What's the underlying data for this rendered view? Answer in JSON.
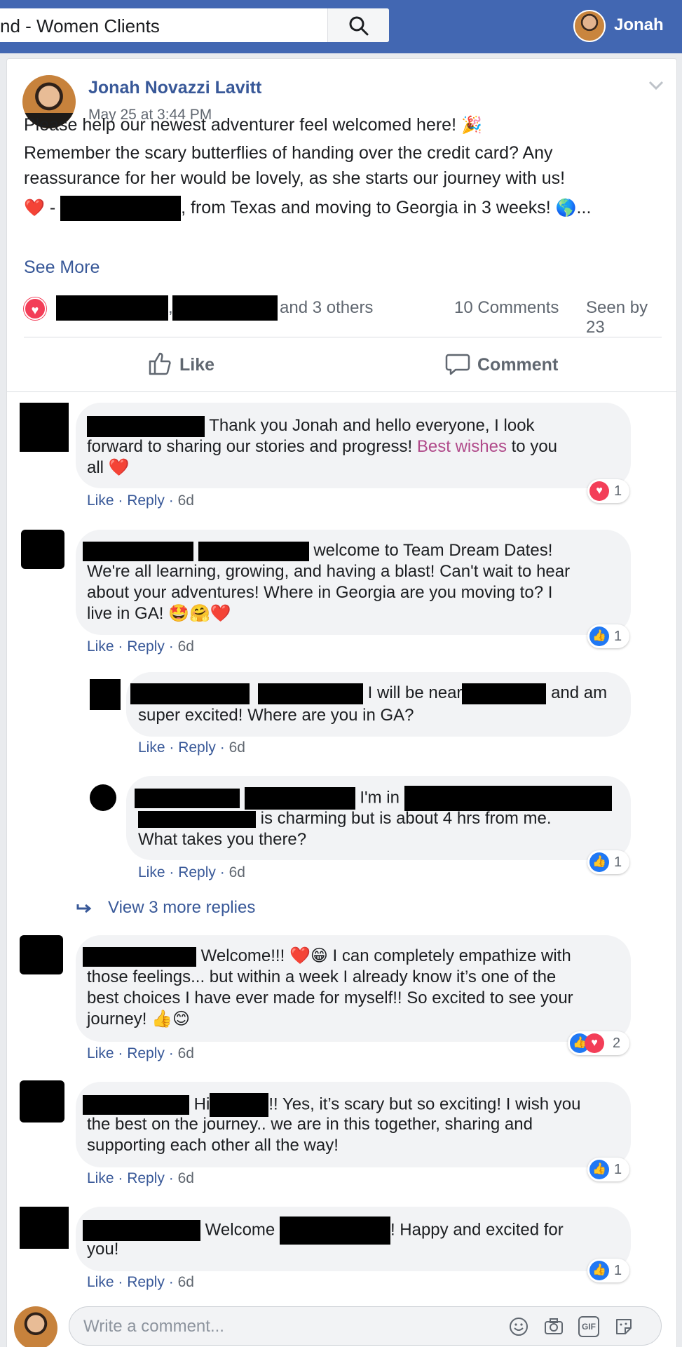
{
  "topbar": {
    "search_value": "nd - Women Clients",
    "user_name": "Jonah"
  },
  "post": {
    "author": "Jonah Novazzi Lavitt",
    "date": "May 25 at 3:44 PM",
    "line1": "Please help our newest adventurer feel welcomed here!",
    "line2": "Remember the scary butterflies of handing over the credit card? Any",
    "line3": "reassurance for her would be lovely, as she starts our journey with us!",
    "line4_dash": "-",
    "line4_text": ", from Texas and moving to Georgia in 3 weeks!",
    "line4_ellipsis": "...",
    "see_more": "See More",
    "reactions_suffix": "and 3 others",
    "comment_count": "10 Comments",
    "seen_by": "Seen by 23",
    "like_label": "Like",
    "comment_label": "Comment"
  },
  "comments": [
    {
      "l1": "Thank you Jonah and hello everyone, I look",
      "l2a": "forward to sharing our stories and progress!",
      "l2b": "Best wishes",
      "l2c": "to you",
      "l3": "all",
      "like": "Like",
      "reply": "Reply",
      "time": "6d",
      "reaction_count": "1"
    },
    {
      "l1": "welcome to Team Dream Dates!",
      "l2": "We're all learning, growing, and having a blast! Can't wait to hear",
      "l3": "about your adventures! Where in Georgia are you moving to? I",
      "l4": "live in GA!",
      "like": "Like",
      "reply": "Reply",
      "time": "6d",
      "reaction_count": "1"
    },
    {
      "l1a": "I will be near",
      "l1b": "and am",
      "l2": "super excited! Where are you in GA?",
      "like": "Like",
      "reply": "Reply",
      "time": "6d"
    },
    {
      "l1": "I'm in",
      "l2": "is charming but is about 4 hrs from me.",
      "l3": "What takes you there?",
      "like": "Like",
      "reply": "Reply",
      "time": "6d",
      "reaction_count": "1"
    },
    {
      "l1a": "Welcome!!!",
      "l1b": "I can completely empathize with",
      "l2": "those feelings... but within a week I already know it’s one of the",
      "l3": "best choices I have ever made for myself!! So excited to see your",
      "l4": "journey!",
      "like": "Like",
      "reply": "Reply",
      "time": "6d",
      "reaction_count": "2"
    },
    {
      "l1a": "Hi",
      "l1b": "!! Yes, it’s scary but so exciting! I wish you",
      "l2": "the best on the journey.. we are in this together, sharing and",
      "l3": "supporting each other all the way!",
      "like": "Like",
      "reply": "Reply",
      "time": "6d",
      "reaction_count": "1"
    },
    {
      "l1a": "Welcome",
      "l1b": "! Happy and excited for",
      "l2": "you!",
      "like": "Like",
      "reply": "Reply",
      "time": "6d",
      "reaction_count": "1"
    }
  ],
  "view_more_replies": "View 3 more replies",
  "composer": {
    "placeholder": "Write a comment...",
    "gif_label": "GIF"
  },
  "colors": {
    "header_blue": "#4267b2",
    "link_blue": "#385898",
    "love_red": "#f33e58",
    "like_blue": "#2078f4",
    "highlight_pink": "#b04a8a"
  },
  "icons": [
    "search-icon",
    "chevron-down-icon",
    "like-thumb-icon",
    "comment-icon",
    "heart-icon",
    "reply-arrow-icon",
    "emoji-icon",
    "camera-icon",
    "gif-icon",
    "sticker-icon"
  ]
}
